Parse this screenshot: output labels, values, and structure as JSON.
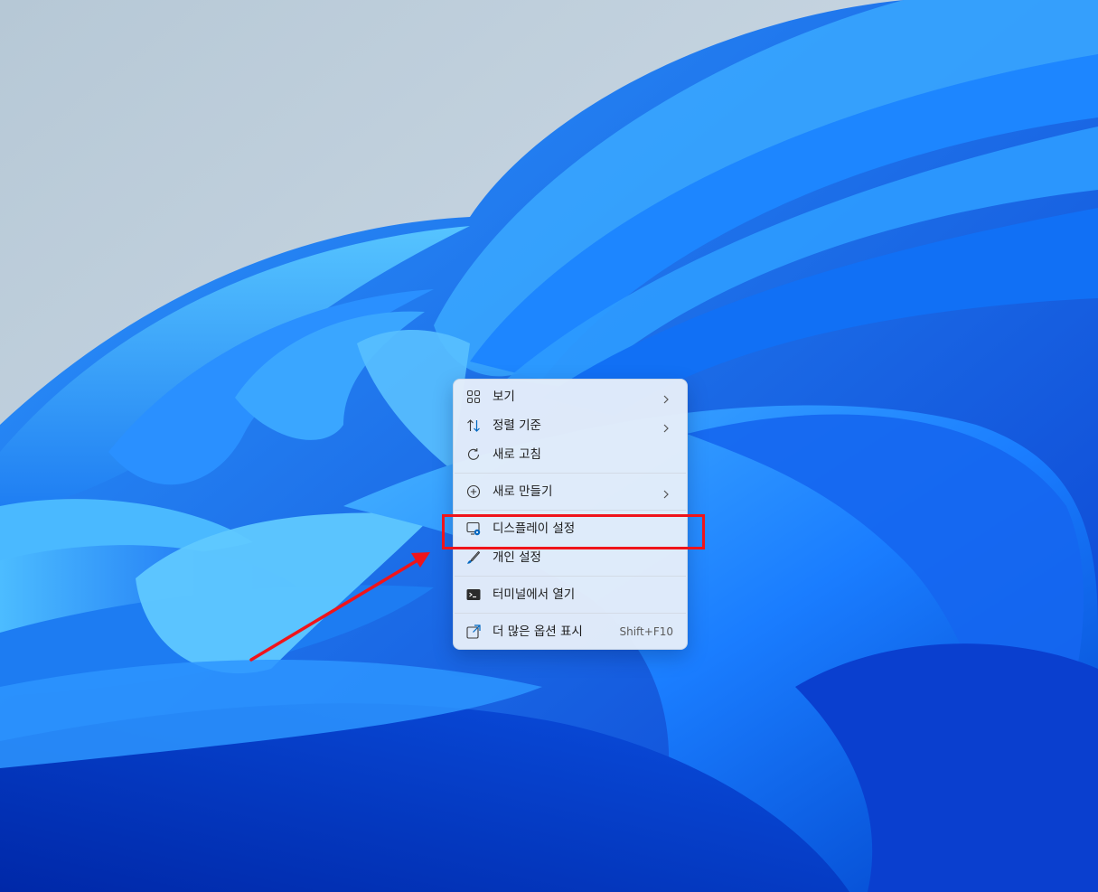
{
  "menu": {
    "items": [
      {
        "label": "보기",
        "icon": "view-grid-icon",
        "submenu": true
      },
      {
        "label": "정렬 기준",
        "icon": "sort-arrows-icon",
        "submenu": true
      },
      {
        "label": "새로 고침",
        "icon": "refresh-icon",
        "submenu": false
      },
      {
        "label": "새로 만들기",
        "icon": "plus-circle-icon",
        "submenu": true
      },
      {
        "label": "디스플레이 설정",
        "icon": "display-settings-icon",
        "submenu": false
      },
      {
        "label": "개인 설정",
        "icon": "brush-icon",
        "submenu": false
      },
      {
        "label": "터미널에서 열기",
        "icon": "terminal-icon",
        "submenu": false
      },
      {
        "label": "더 많은 옵션 표시",
        "icon": "more-options-icon",
        "submenu": false,
        "shortcut": "Shift+F10"
      }
    ]
  },
  "colors": {
    "accent": "#0067c0",
    "highlight": "#f0141a",
    "menu_background": "#e6eefa"
  }
}
